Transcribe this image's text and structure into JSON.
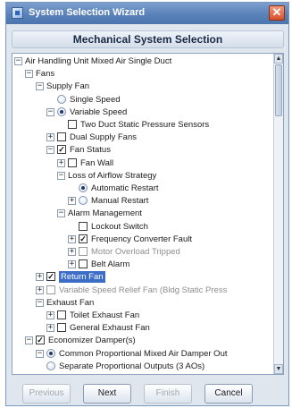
{
  "window": {
    "title": "System Selection Wizard",
    "close_glyph": "✕"
  },
  "header": {
    "title": "Mechanical System Selection"
  },
  "tree": {
    "rows": [
      {
        "label": "Air Handling Unit Mixed Air Single Duct",
        "control": "none",
        "expander": "−",
        "disabled": false
      },
      {
        "label": "Fans",
        "control": "none",
        "expander": "−",
        "disabled": false
      },
      {
        "label": "Supply Fan",
        "control": "none",
        "expander": "−",
        "disabled": false
      },
      {
        "label": "Single Speed",
        "control": "radio",
        "checked": false,
        "disabled": false
      },
      {
        "label": "Variable Speed",
        "control": "radio",
        "checked": true,
        "expander": "−",
        "disabled": false
      },
      {
        "label": "Two Duct Static Pressure Sensors",
        "control": "checkbox",
        "checked": false,
        "disabled": false
      },
      {
        "label": "Dual Supply Fans",
        "control": "checkbox",
        "checked": false,
        "expander": "+",
        "disabled": false
      },
      {
        "label": "Fan Status",
        "control": "checkbox",
        "checked": true,
        "expander": "−",
        "disabled": false
      },
      {
        "label": "Fan Wall",
        "control": "checkbox",
        "checked": false,
        "expander": "+",
        "disabled": false
      },
      {
        "label": "Loss of Airflow Strategy",
        "control": "none",
        "expander": "−",
        "disabled": false
      },
      {
        "label": "Automatic Restart",
        "control": "radio",
        "checked": true,
        "disabled": false
      },
      {
        "label": "Manual Restart",
        "control": "radio",
        "checked": false,
        "expander": "+",
        "disabled": false
      },
      {
        "label": "Alarm Management",
        "control": "none",
        "expander": "−",
        "disabled": false
      },
      {
        "label": "Lockout Switch",
        "control": "checkbox",
        "checked": false,
        "disabled": false
      },
      {
        "label": "Frequency Converter Fault",
        "control": "checkbox",
        "checked": true,
        "expander": "+",
        "disabled": false
      },
      {
        "label": "Motor Overload Tripped",
        "control": "checkbox",
        "checked": false,
        "expander": "+",
        "disabled": true
      },
      {
        "label": "Belt Alarm",
        "control": "checkbox",
        "checked": false,
        "expander": "+",
        "disabled": false
      },
      {
        "label": "Return Fan",
        "control": "checkbox",
        "checked": true,
        "expander": "+",
        "disabled": false,
        "selected": true
      },
      {
        "label": "Variable Speed Relief Fan (Bldg Static Press",
        "control": "checkbox",
        "checked": false,
        "expander": "+",
        "disabled": true
      },
      {
        "label": "Exhaust Fan",
        "control": "none",
        "expander": "−",
        "disabled": false
      },
      {
        "label": "Toilet Exhaust Fan",
        "control": "checkbox",
        "checked": false,
        "expander": "+",
        "disabled": false
      },
      {
        "label": "General Exhaust Fan",
        "control": "checkbox",
        "checked": false,
        "expander": "+",
        "disabled": false
      },
      {
        "label": "Economizer Damper(s)",
        "control": "checkbox",
        "checked": true,
        "expander": "−",
        "disabled": false
      },
      {
        "label": "Common Proportional Mixed Air Damper Out",
        "control": "radio",
        "checked": true,
        "expander": "−",
        "disabled": false
      },
      {
        "label": "Separate Proportional Outputs (3 AOs)",
        "control": "radio",
        "checked": false,
        "disabled": false
      }
    ]
  },
  "scrollbar": {
    "up_glyph": "▲",
    "down_glyph": "▼"
  },
  "footer": {
    "previous": "Previous",
    "next": "Next",
    "finish": "Finish",
    "cancel": "Cancel"
  }
}
